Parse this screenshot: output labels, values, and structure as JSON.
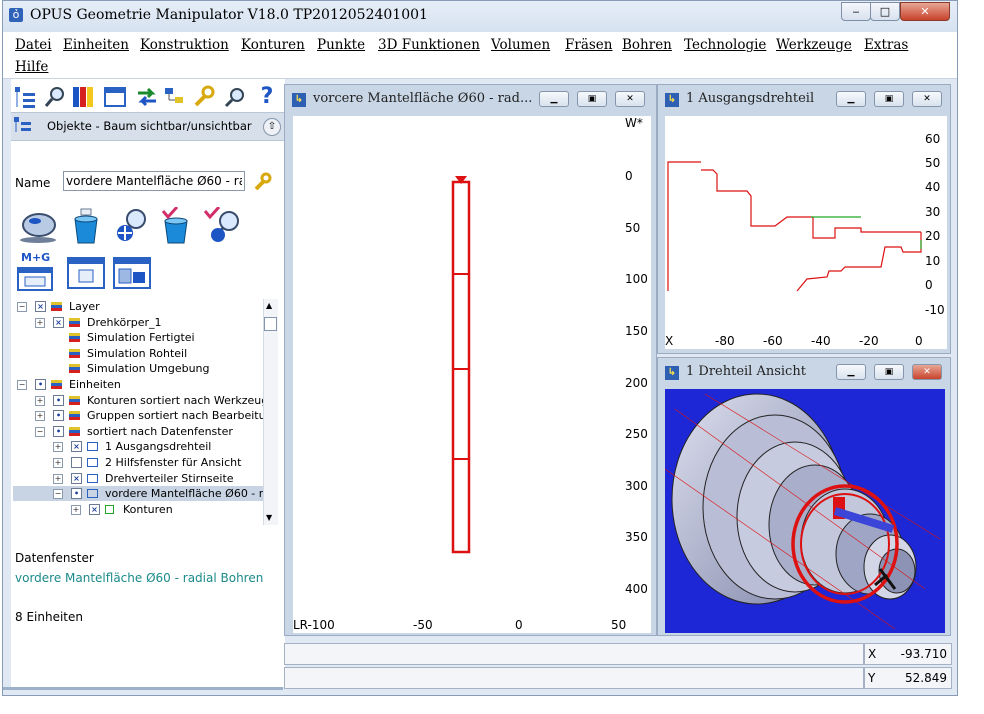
{
  "window": {
    "title": "OPUS Geometrie Manipulator V18.0   TP2012052401001",
    "controls": {
      "minimize": "‒",
      "maximize": "□",
      "close": "✕"
    }
  },
  "menu": [
    "Datei",
    "Einheiten",
    "Konstruktion",
    "Konturen",
    "Punkte",
    "3D Funktionen",
    "Volumen",
    "Fräsen",
    "Bohren",
    "Technologie",
    "Werkzeuge",
    "Extras",
    "Hilfe"
  ],
  "left_panel": {
    "object_tree_toggle": "Objekte - Baum sichtbar/unsichtbar",
    "name_label": "Name",
    "name_value": "vordere Mantelfläche Ø60 - radi",
    "mg_label": "M+G",
    "tree": [
      {
        "label": "Layer",
        "level": 0,
        "checked": "x"
      },
      {
        "label": "Drehkörper_1",
        "level": 1,
        "checked": "x"
      },
      {
        "label": "Simulation Fertigtei",
        "level": 1,
        "checked": ""
      },
      {
        "label": "Simulation Rohteil",
        "level": 1,
        "checked": ""
      },
      {
        "label": "Simulation Umgebung",
        "level": 1,
        "checked": ""
      },
      {
        "label": "Einheiten",
        "level": 0,
        "checked": "dot"
      },
      {
        "label": "Konturen sortiert nach Werkzeug",
        "level": 1,
        "checked": "dot"
      },
      {
        "label": "Gruppen sortiert nach Bearbeitu",
        "level": 1,
        "checked": "dot"
      },
      {
        "label": "sortiert nach Datenfenster",
        "level": 1,
        "checked": "dot"
      },
      {
        "label": "1 Ausgangsdrehteil",
        "level": 2,
        "checked": "x"
      },
      {
        "label": "2 Hilfsfenster für Ansicht",
        "level": 2,
        "checked": ""
      },
      {
        "label": "Drehverteiler Stirnseite",
        "level": 2,
        "checked": "x"
      },
      {
        "label": "vordere Mantelfläche Ø60 - ra",
        "level": 2,
        "checked": "dot",
        "selected": true
      },
      {
        "label": "Konturen",
        "level": 3,
        "checked": "x"
      }
    ],
    "datenfenster_label": "Datenfenster",
    "datenfenster_value": "vordere Mantelfläche Ø60 - radial Bohren",
    "units_count": "8 Einheiten"
  },
  "view_main": {
    "title": "vorcere Mantelfläche Ø60 - rad...",
    "corner_label": "W*",
    "y_ticks": [
      "0",
      "50",
      "100",
      "150",
      "200",
      "250",
      "300",
      "350",
      "400"
    ],
    "x_axis_label": "LR-100",
    "x_ticks": [
      "-50",
      "0",
      "50"
    ]
  },
  "view_top_right": {
    "title": "1 Ausgangsdrehteil",
    "y_ticks": [
      "60",
      "50",
      "40",
      "30",
      "20",
      "10",
      "0",
      "-10"
    ],
    "x_axis_label": "X",
    "x_ticks": [
      "-80",
      "-60",
      "-40",
      "-20",
      "0"
    ]
  },
  "view_3d": {
    "title": "1 Drehteil Ansicht"
  },
  "status": {
    "x_label": "X",
    "x_value": "-93.710",
    "y_label": "Y",
    "y_value": "52.849"
  },
  "colors": {
    "accent_red": "#dd1111",
    "teal_text": "#1b8a8a",
    "viewport_3d_bg": "#1d27d6",
    "selection": "#c8d4e3"
  }
}
